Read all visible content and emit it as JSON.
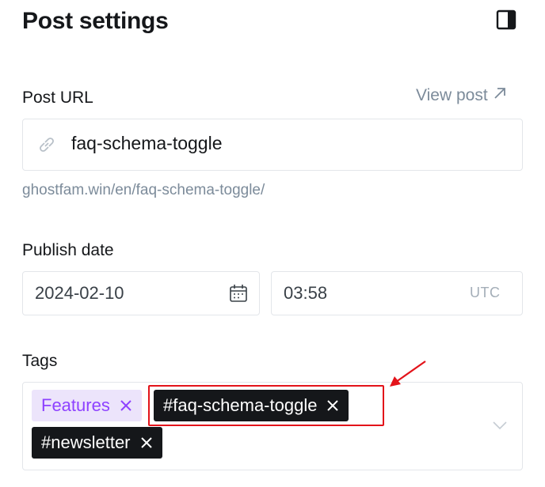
{
  "header": {
    "title": "Post settings",
    "panel_icon": "sidebar-panel-icon"
  },
  "post_url": {
    "label": "Post URL",
    "view_post": "View post",
    "value": "faq-schema-toggle",
    "preview": "ghostfam.win/en/faq-schema-toggle/"
  },
  "publish_date": {
    "label": "Publish date",
    "date": "2024-02-10",
    "time": "03:58",
    "timezone": "UTC"
  },
  "tags": {
    "label": "Tags",
    "items": [
      "Features",
      "#faq-schema-toggle",
      "#newsletter"
    ]
  },
  "colors": {
    "accent_purple": "#8e42ff",
    "tag_purple_bg": "#ece4fb",
    "dark_tag_bg": "#15171a",
    "annotation_red": "#e3131a",
    "muted_text": "#7c8b9a"
  }
}
